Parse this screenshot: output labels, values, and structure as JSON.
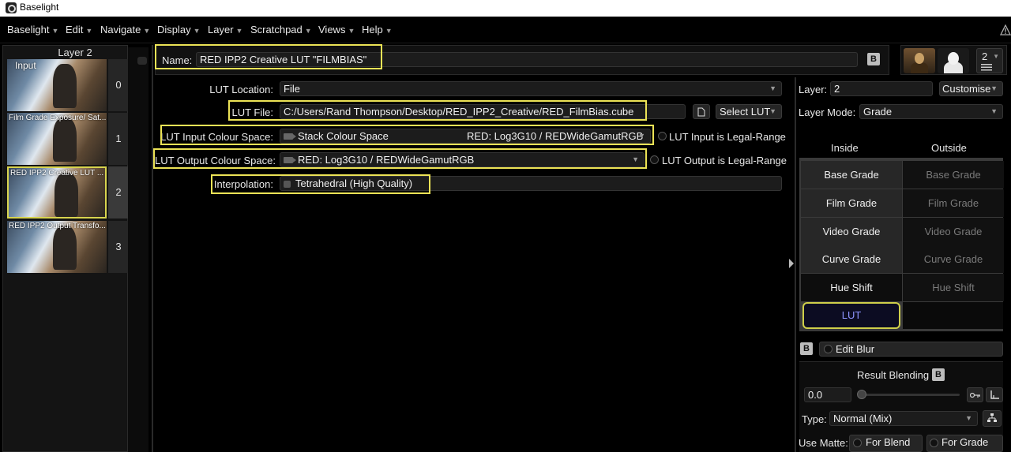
{
  "app": {
    "title": "Baselight"
  },
  "menu": [
    {
      "label": "Baselight"
    },
    {
      "label": "Edit"
    },
    {
      "label": "Navigate"
    },
    {
      "label": "Display"
    },
    {
      "label": "Layer"
    },
    {
      "label": "Scratchpad"
    },
    {
      "label": "Views"
    },
    {
      "label": "Help"
    }
  ],
  "layers": {
    "title": "Layer 2",
    "items": [
      {
        "label": "Input",
        "number": "0"
      },
      {
        "label": "Film Grade Exposure/ Sat...",
        "number": "1"
      },
      {
        "label": "RED IPP2 Creative LUT ...",
        "number": "2",
        "selected": true
      },
      {
        "label": "RED IPP2 Output Transfo...",
        "number": "3"
      }
    ]
  },
  "editor": {
    "name_label": "Name:",
    "name_value": "RED IPP2 Creative LUT \"FILMBIAS\"",
    "lut_location_label": "LUT Location:",
    "lut_location_value": "File",
    "lut_file_label": "LUT File:",
    "lut_file_value": "C:/Users/Rand Thompson/Desktop/RED_IPP2_Creative/RED_FilmBias.cube",
    "select_lut_label": "Select LUT",
    "input_cs_label": "LUT Input Colour Space:",
    "input_cs_value": "Stack Colour Space",
    "input_cs_resolved": "RED: Log3G10 / REDWideGamutRGB",
    "input_legal_label": "LUT Input is Legal-Range",
    "output_cs_label": "LUT Output Colour Space:",
    "output_cs_value": "RED: Log3G10 / REDWideGamutRGB",
    "output_legal_label": "LUT Output is Legal-Range",
    "interp_label": "Interpolation:",
    "interp_value": "Tetrahedral (High Quality)"
  },
  "right_panel": {
    "layer_count": "2",
    "layer_label": "Layer:",
    "layer_value": "2",
    "customise_label": "Customise",
    "layer_mode_label": "Layer Mode:",
    "layer_mode_value": "Grade",
    "inside_label": "Inside",
    "outside_label": "Outside",
    "grades": [
      "Base Grade",
      "Film Grade",
      "Video Grade",
      "Curve Grade",
      "Hue Shift"
    ],
    "lut_label": "LUT",
    "edit_blur_label": "Edit Blur",
    "result_blending_label": "Result Blending",
    "blend_value": "0.0",
    "type_label": "Type:",
    "type_value": "Normal (Mix)",
    "use_matte_label": "Use Matte:",
    "for_blend_label": "For Blend",
    "for_grade_label": "For Grade",
    "b_label": "B"
  },
  "colors": {
    "highlight": "#ece356",
    "lut_text": "#8e95ff",
    "background": "#000000"
  }
}
